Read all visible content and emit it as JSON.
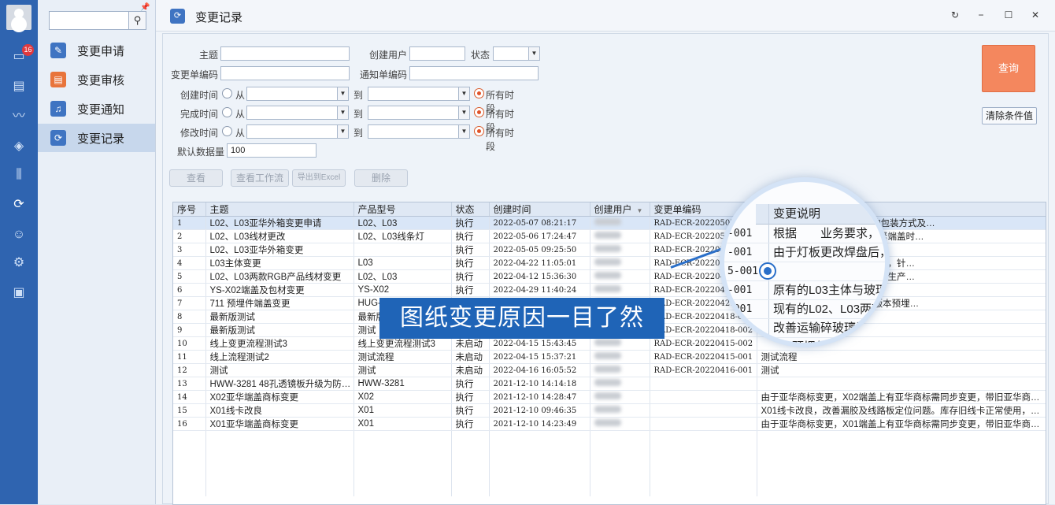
{
  "rail": {
    "badge_count": "16"
  },
  "nav": {
    "search_placeholder": "",
    "items": [
      {
        "label": "变更申请",
        "icon": "form-icon",
        "color": "#3f74c2"
      },
      {
        "label": "变更审核",
        "icon": "audit-icon",
        "color": "#e8743b"
      },
      {
        "label": "变更通知",
        "icon": "bell-icon",
        "color": "#3f74c2"
      },
      {
        "label": "变更记录",
        "icon": "record-icon",
        "color": "#3f74c2"
      }
    ]
  },
  "window": {
    "title": "变更记录"
  },
  "filters": {
    "subject_label": "主题",
    "creator_label": "创建用户",
    "status_label": "状态",
    "change_no_label": "变更单编码",
    "notice_no_label": "通知单编码",
    "created_label": "创建时间",
    "completed_label": "完成时间",
    "modified_label": "修改时间",
    "from_label": "从",
    "to_label": "到",
    "all_periods_label": "所有时段",
    "default_count_label": "默认数据量",
    "default_count_value": "100"
  },
  "buttons": {
    "query": "查询",
    "clear": "清除条件值",
    "view": "查看",
    "view_workflow": "查看工作流",
    "export_excel": "导出到Excel",
    "delete": "删除"
  },
  "table": {
    "columns": [
      "序号",
      "主题",
      "产品型号",
      "状态",
      "创建时间",
      "创建用户",
      "变更单编码",
      "变更说明"
    ],
    "rows": [
      [
        "1",
        "L02、L03亚华外箱变更申请",
        "L02、L03",
        "执行",
        "2022-05-07 08:21:17",
        "RAD-ECR-20220507-001",
        "2、L03亚华包装外箱，产品的包装方式及…"
      ],
      [
        "2",
        "L02、L03线材更改",
        "L02、L03线条灯",
        "执行",
        "2022-05-06 17:24:47",
        "RAD-ECR-20220506-001",
        "出线长度比更改前长，导致锁紧端盖时…"
      ],
      [
        "3",
        "L02、L03亚华外箱变更",
        "",
        "执行",
        "2022-05-05 09:25:50",
        "RAD-ECR-20220505-001",
        ""
      ],
      [
        "4",
        "L03主体变更",
        "L03",
        "执行",
        "2022-04-22 11:05:01",
        "RAD-ECR-20220422-001",
        "大，会出现玻璃左右晃动的问题，针…"
      ],
      [
        "5",
        "L02、L03两款RGB产品线材变更",
        "L02、L03",
        "执行",
        "2022-04-12 15:36:30",
        "RAD-ECR-20220412-001",
        "于公母线对接线剥线过长，影响生产…"
      ],
      [
        "6",
        "YS-X02端盖及包材变更",
        "YS-X02",
        "执行",
        "2022-04-29 11:40:24",
        "RAD-ECR-20220429-001",
        "端盖及包材"
      ],
      [
        "7",
        "711 预埋件端盖变更",
        "HUG-711",
        "执行",
        "2022-04-21 09:12:10",
        "RAD-ECR-20220421-001",
        "版本升级到A1版本。库存A0版本预埋…"
      ],
      [
        "8",
        "最新版测试",
        "最新版",
        "执行",
        "2022-04-18 10:20:11",
        "RAD-ECR-20220418-001",
        ""
      ],
      [
        "9",
        "最新版测试",
        "测试",
        "执行",
        "2022-04-18 10:31:05",
        "RAD-ECR-20220418-002",
        ""
      ],
      [
        "10",
        "线上变更流程测试3",
        "线上变更流程测试3",
        "未启动",
        "2022-04-15 15:43:45",
        "RAD-ECR-20220415-002",
        ""
      ],
      [
        "11",
        "线上流程测试2",
        "测试流程",
        "未启动",
        "2022-04-15 15:37:21",
        "RAD-ECR-20220415-001",
        "测试流程"
      ],
      [
        "12",
        "测试",
        "测试",
        "未启动",
        "2022-04-16 16:05:52",
        "RAD-ECR-20220416-001",
        "测试"
      ],
      [
        "13",
        "HWW-3281 48孔透镜板升级为防眩筒",
        "HWW-3281",
        "执行",
        "2021-12-10 14:14:18",
        "",
        ""
      ],
      [
        "14",
        "X02亚华端盖商标变更",
        "X02",
        "执行",
        "2021-12-10 14:28:47",
        "",
        "由于亚华商标变更，X02端盖上有亚华商标需同步变更，带旧亚华商标…"
      ],
      [
        "15",
        "X01线卡改良",
        "X01",
        "执行",
        "2021-12-10 09:46:35",
        "",
        "X01线卡改良，改善漏胶及线路板定位问题。库存旧线卡正常使用，用…"
      ],
      [
        "16",
        "X01亚华端盖商标变更",
        "X01",
        "执行",
        "2021-12-10 14:23:49",
        "",
        "由于亚华商标变更，X01端盖上有亚华商标需同步变更，带旧亚华商标…"
      ]
    ]
  },
  "magnifier": {
    "header": "变更说明",
    "rows": [
      {
        "code": "-001",
        "text": "根据　　业务要求，"
      },
      {
        "code": "-001",
        "text": "由于灯板更改焊盘后，"
      },
      {
        "code": "5-001",
        "text": ""
      },
      {
        "code": "-001",
        "text": "原有的L03主体与玻璃"
      },
      {
        "code": "-001",
        "text": "现有的L02、L03两款"
      },
      {
        "code": "-001",
        "text": "改善运输碎玻璃问题"
      },
      {
        "code": "-00.",
        "text": "711预埋件端盖尺"
      }
    ]
  },
  "banner": "图纸变更原因一目了然"
}
